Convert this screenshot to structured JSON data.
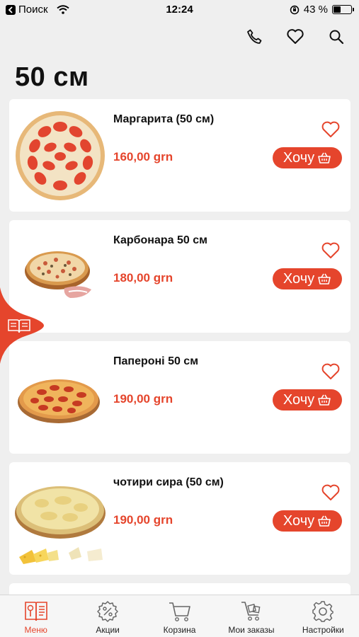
{
  "status_bar": {
    "back_label": "Поиск",
    "time": "12:24",
    "battery_text": "43 %",
    "battery_level": 0.43
  },
  "header": {
    "title": "50 см",
    "icons": [
      "phone-icon",
      "heart-icon",
      "search-icon"
    ]
  },
  "products": [
    {
      "name": "Маргарита (50 см)",
      "price": "160,00 grn",
      "button": "Хочу"
    },
    {
      "name": "Карбонара 50 см",
      "price": "180,00 grn",
      "button": "Хочу"
    },
    {
      "name": "Папероні 50 см",
      "price": "190,00 grn",
      "button": "Хочу"
    },
    {
      "name": "чотири сира (50 см)",
      "price": "190,00 grn",
      "button": "Хочу"
    }
  ],
  "bottom_nav": {
    "items": [
      {
        "label": "Меню",
        "icon": "menu-book-icon",
        "active": true
      },
      {
        "label": "Акции",
        "icon": "discount-icon",
        "active": false
      },
      {
        "label": "Корзина",
        "icon": "cart-icon",
        "active": false
      },
      {
        "label": "Мои заказы",
        "icon": "orders-cart-icon",
        "active": false
      },
      {
        "label": "Настройки",
        "icon": "gear-icon",
        "active": false
      }
    ]
  },
  "colors": {
    "accent": "#e5452c",
    "background": "#efefef",
    "card": "#ffffff"
  }
}
